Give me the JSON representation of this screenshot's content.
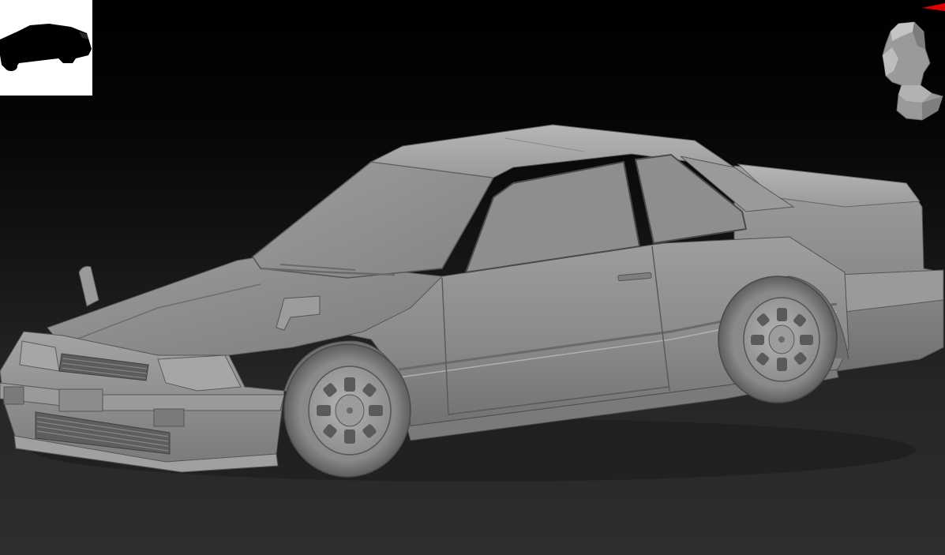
{
  "canvas": {
    "background_top": "#000000",
    "background_bottom": "#2e2e2e",
    "model_material_color": "#8e8e8e"
  },
  "model": {
    "icon": "car-model"
  },
  "navigator": {
    "thumbnail_icon": "car-silhouette-icon",
    "thumbnail_background": "#ffffff",
    "orientation_icon": "head-orientation-icon",
    "axis_marker_color": "#e00000"
  }
}
